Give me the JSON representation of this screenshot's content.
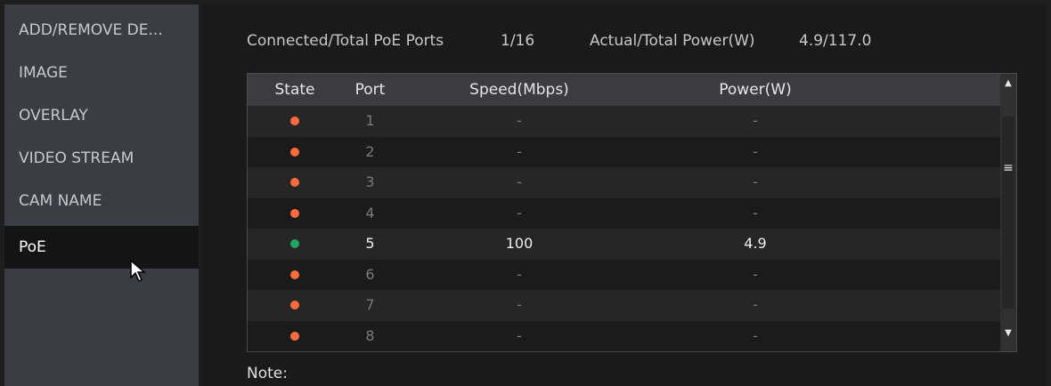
{
  "sidebar": {
    "items": [
      {
        "label": "ADD/REMOVE DE...",
        "active": false
      },
      {
        "label": "IMAGE",
        "active": false
      },
      {
        "label": "OVERLAY",
        "active": false
      },
      {
        "label": "VIDEO STREAM",
        "active": false
      },
      {
        "label": "CAM NAME",
        "active": false
      },
      {
        "label": "PoE",
        "active": true
      }
    ]
  },
  "summary": {
    "ports_label": "Connected/Total PoE Ports",
    "ports_value": "1/16",
    "power_label": "Actual/Total Power(W)",
    "power_value": "4.9/117.0"
  },
  "table": {
    "headers": {
      "state": "State",
      "port": "Port",
      "speed": "Speed(Mbps)",
      "power": "Power(W)"
    },
    "rows": [
      {
        "port": "1",
        "speed": "-",
        "power": "-",
        "state": "error"
      },
      {
        "port": "2",
        "speed": "-",
        "power": "-",
        "state": "error"
      },
      {
        "port": "3",
        "speed": "-",
        "power": "-",
        "state": "error"
      },
      {
        "port": "4",
        "speed": "-",
        "power": "-",
        "state": "error"
      },
      {
        "port": "5",
        "speed": "100",
        "power": "4.9",
        "state": "ok"
      },
      {
        "port": "6",
        "speed": "-",
        "power": "-",
        "state": "error"
      },
      {
        "port": "7",
        "speed": "-",
        "power": "-",
        "state": "error"
      },
      {
        "port": "8",
        "speed": "-",
        "power": "-",
        "state": "error"
      }
    ]
  },
  "status_colors": {
    "ok": "#1fa463",
    "error": "#ff6b3d"
  },
  "icons": {
    "scroll_up": "triangle-up",
    "scroll_down": "triangle-down",
    "scroll_grip": "grip-lines",
    "cursor": "mouse-pointer"
  },
  "note": {
    "label": "Note:"
  }
}
